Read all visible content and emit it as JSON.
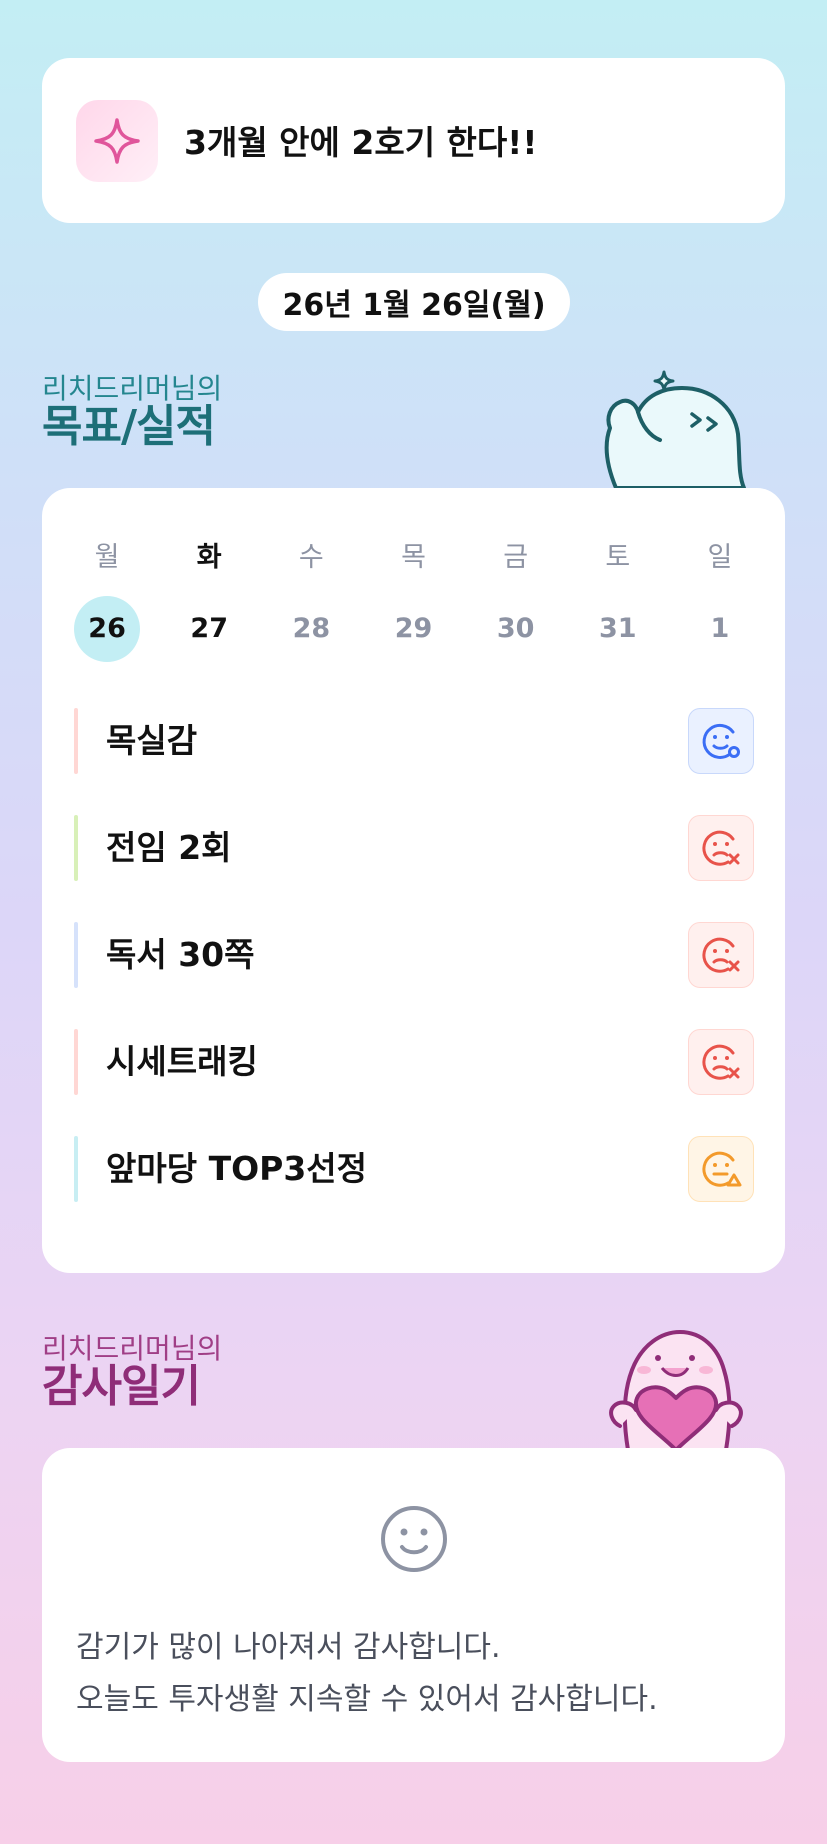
{
  "goal_banner": {
    "text": "3개월 안에 2호기 한다!!",
    "icon": "sparkle-icon"
  },
  "date": "26년 1월 26일(월)",
  "goals_section": {
    "owner": "리치드리머님의",
    "title": "목표/실적"
  },
  "calendar": {
    "weekdays": [
      "월",
      "화",
      "수",
      "목",
      "금",
      "토",
      "일"
    ],
    "dates": [
      "26",
      "27",
      "28",
      "29",
      "30",
      "31",
      "1"
    ]
  },
  "tasks": [
    {
      "name": "목실감",
      "status": "good-face-icon",
      "bar_color": "#ffd7d4"
    },
    {
      "name": "전임 2회",
      "status": "bad-face-icon",
      "bar_color": "#d8f0b8"
    },
    {
      "name": "독서 30쪽",
      "status": "bad-face-icon",
      "bar_color": "#d6e2fb"
    },
    {
      "name": "시세트래킹",
      "status": "bad-face-icon",
      "bar_color": "#ffd7d4"
    },
    {
      "name": "앞마당 TOP3선정",
      "status": "warn-face-icon",
      "bar_color": "#c8eef3"
    }
  ],
  "gratitude_section": {
    "owner": "리치드리머님의",
    "title": "감사일기"
  },
  "gratitude": {
    "icon": "smile-icon",
    "lines": [
      "감기가 많이 나아져서 감사합니다.",
      "오늘도 투자생활 지속할 수 있어서 감사합니다."
    ]
  },
  "colors": {
    "good": "#3b6ef5",
    "bad": "#e8534a",
    "warn": "#f39a2b",
    "accent": "#c3eef4"
  }
}
